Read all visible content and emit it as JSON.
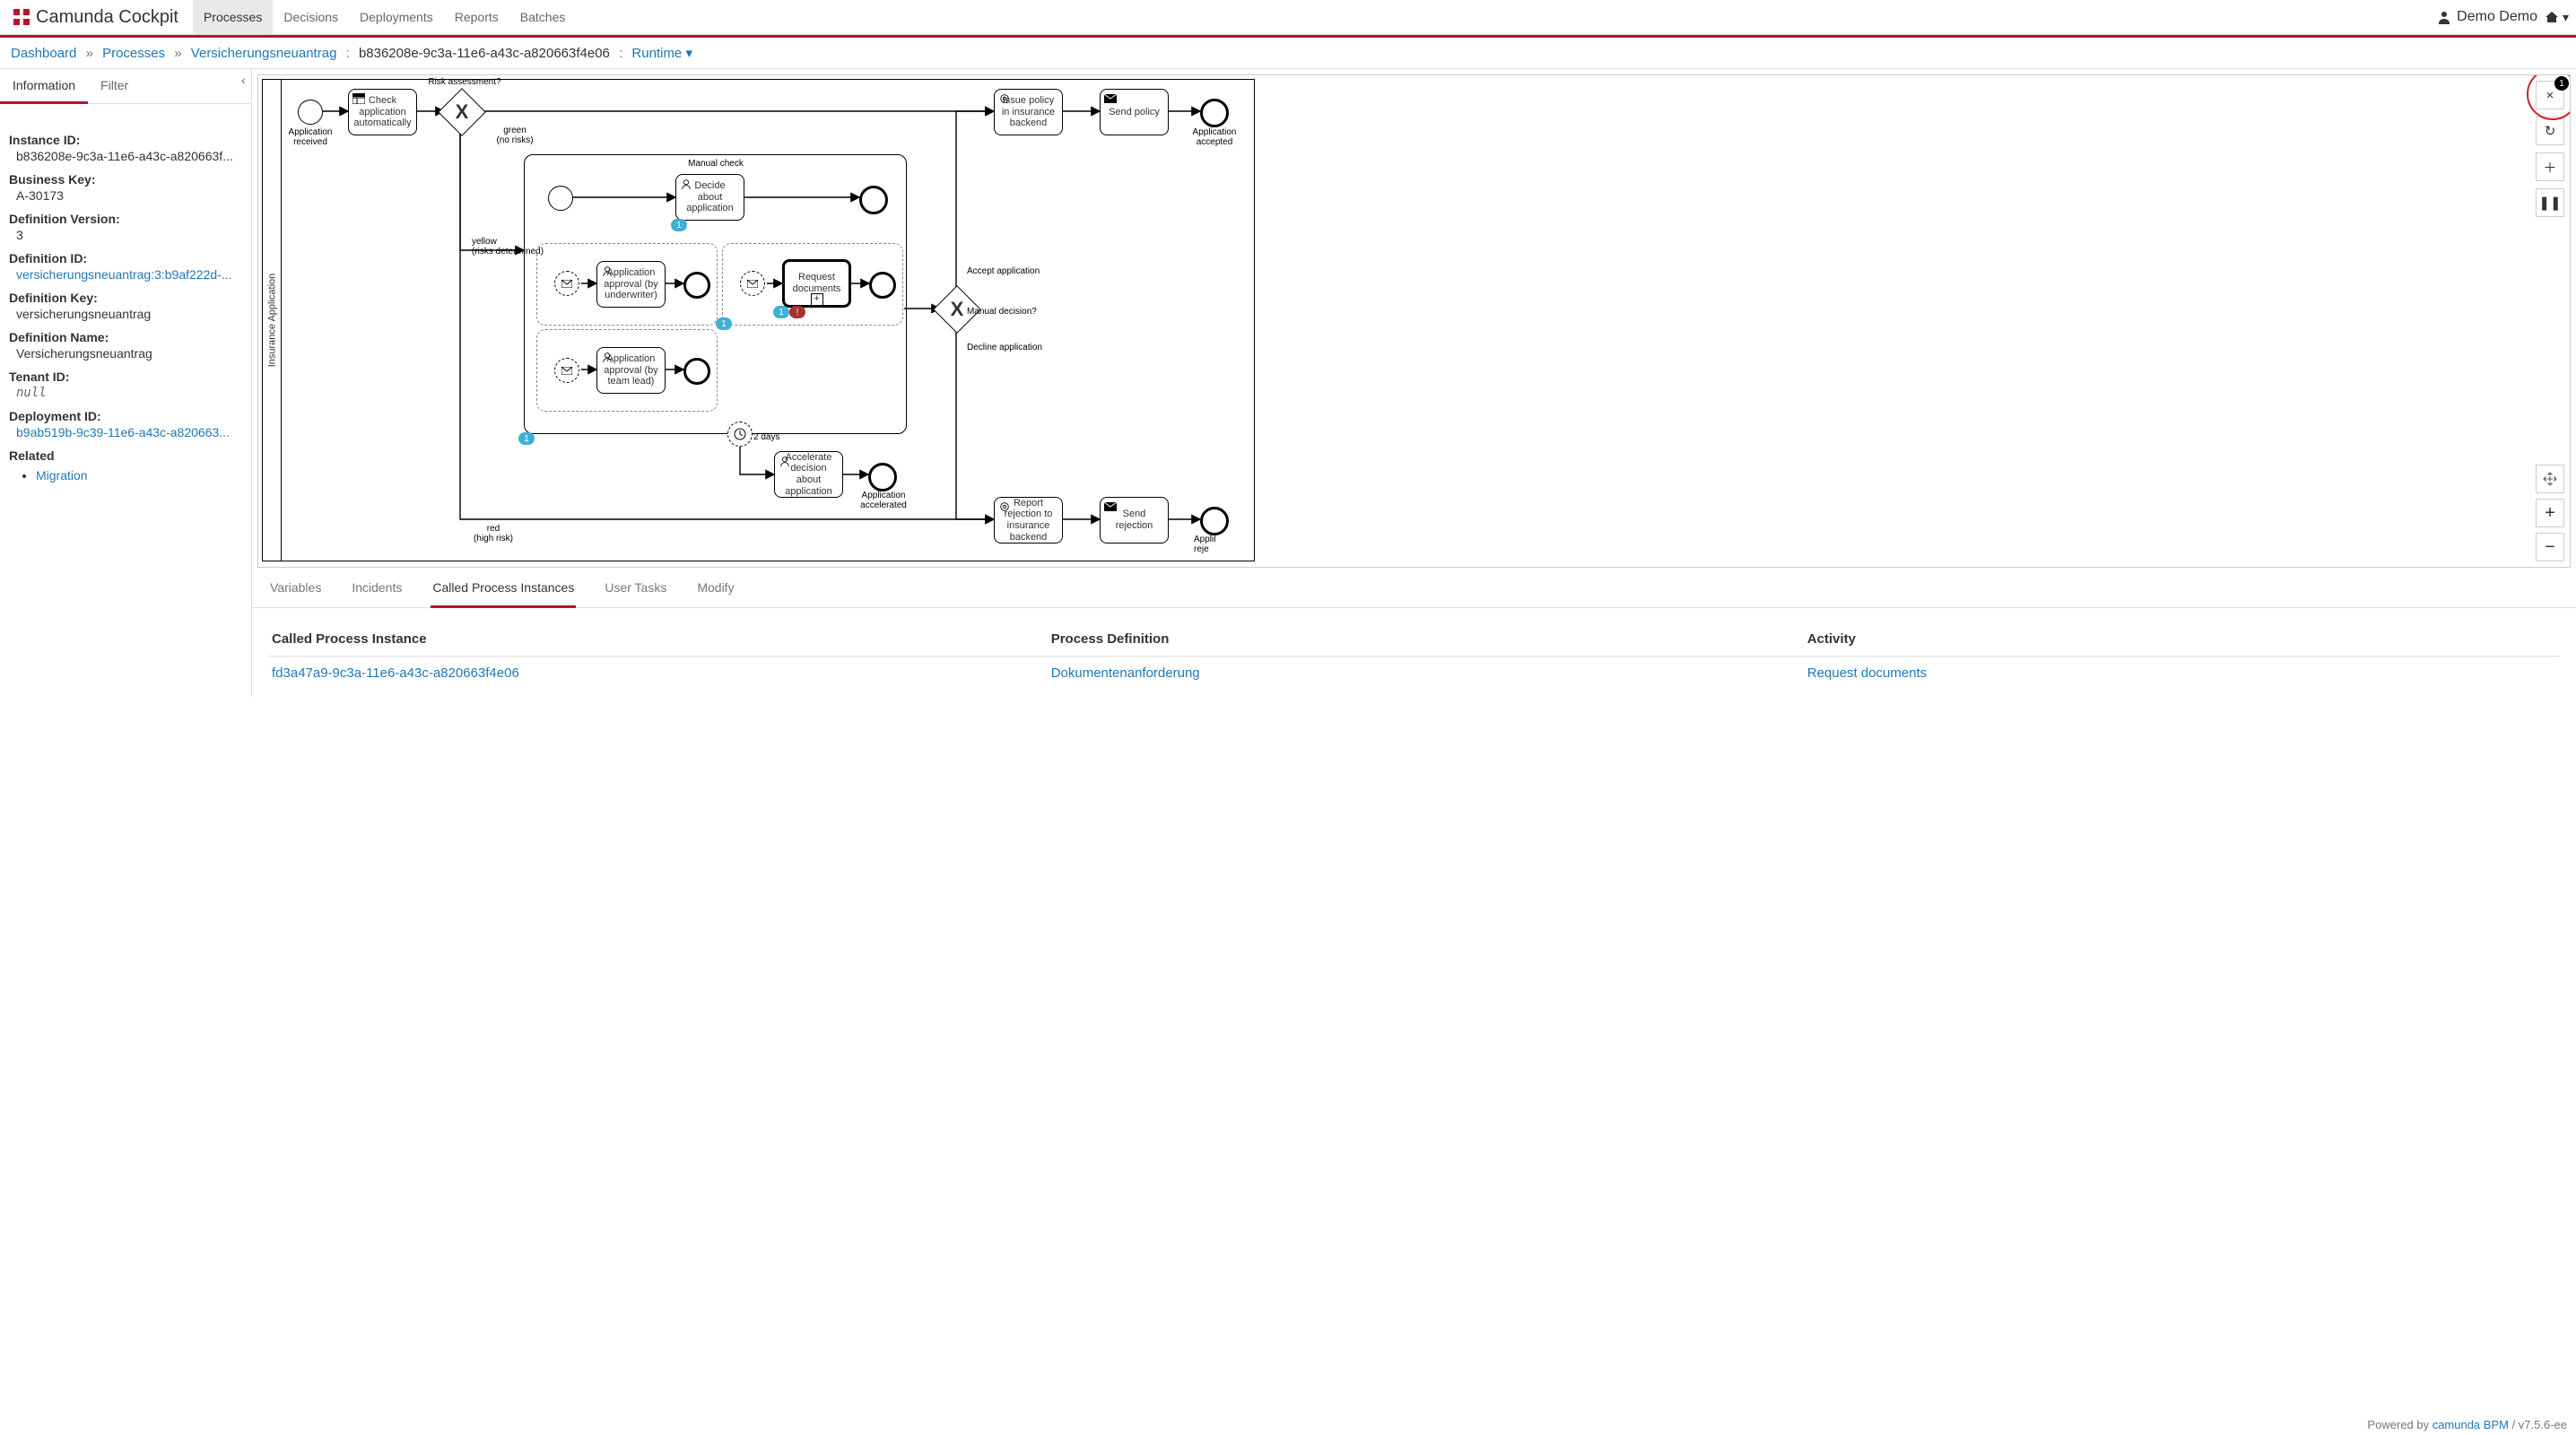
{
  "header": {
    "app_name": "Camunda Cockpit",
    "nav": [
      "Processes",
      "Decisions",
      "Deployments",
      "Reports",
      "Batches"
    ],
    "active_nav": 0,
    "user": "Demo Demo"
  },
  "breadcrumb": {
    "dashboard": "Dashboard",
    "processes": "Processes",
    "definition": "Versicherungsneuantrag",
    "instance_id": "b836208e-9c3a-11e6-a43c-a820663f4e06",
    "view": "Runtime"
  },
  "sidebar": {
    "tabs": {
      "information": "Information",
      "filter": "Filter"
    },
    "fields": {
      "instance_id_label": "Instance ID:",
      "instance_id": "b836208e-9c3a-11e6-a43c-a820663f...",
      "business_key_label": "Business Key:",
      "business_key": "A-30173",
      "def_version_label": "Definition Version:",
      "def_version": "3",
      "def_id_label": "Definition ID:",
      "def_id": "versicherungsneuantrag:3:b9af222d-...",
      "def_key_label": "Definition Key:",
      "def_key": "versicherungsneuantrag",
      "def_name_label": "Definition Name:",
      "def_name": "Versicherungsneuantrag",
      "tenant_id_label": "Tenant ID:",
      "tenant_id": "null",
      "deployment_id_label": "Deployment ID:",
      "deployment_id": "b9ab519b-9c39-11e6-a43c-a820663...",
      "related_label": "Related",
      "related_migration": "Migration"
    }
  },
  "diagram": {
    "pool_label": "Insurance Application",
    "start_label": "Application received",
    "task_check_auto": "Check application automatically",
    "gw_risk_label": "Risk assessment?",
    "path_green": "green\n(no risks)",
    "path_yellow": "yellow\n(risks determined)",
    "path_red": "red\n(high risk)",
    "task_issue_policy": "Issue policy in insurance backend",
    "task_send_policy": "Send policy",
    "end_accepted": "Application accepted",
    "subproc_label": "Manual check",
    "task_decide": "Decide about application",
    "task_appr_underwriter": "Application approval (by underwriter)",
    "task_appr_teamlead": "Application approval (by team lead)",
    "task_request_docs": "Request documents",
    "gw_manual_label": "Manual decision?",
    "path_accept": "Accept application",
    "path_decline": "Decline application",
    "timer_label": "2 days",
    "task_accelerate": "Accelerate decision about application",
    "end_accelerated": "Application accelerated",
    "task_report_rejection": "Report rejection to insurance backend",
    "task_send_rejection": "Send rejection",
    "end_rejected_partial": "Applil reje",
    "badges": {
      "decide": "1",
      "inner": "1",
      "request_incident": "!",
      "subproc": "1"
    },
    "notif_count": "1"
  },
  "detail_tabs": [
    "Variables",
    "Incidents",
    "Called Process Instances",
    "User Tasks",
    "Modify"
  ],
  "detail_active": 2,
  "called_table": {
    "cols": [
      "Called Process Instance",
      "Process Definition",
      "Activity"
    ],
    "row": {
      "id": "fd3a47a9-9c3a-11e6-a43c-a820663f4e06",
      "def": "Dokumentenanforderung",
      "activity": "Request documents"
    }
  },
  "footer": {
    "prefix": "Powered by ",
    "link": "camunda BPM",
    "version": " / v7.5.6-ee"
  }
}
